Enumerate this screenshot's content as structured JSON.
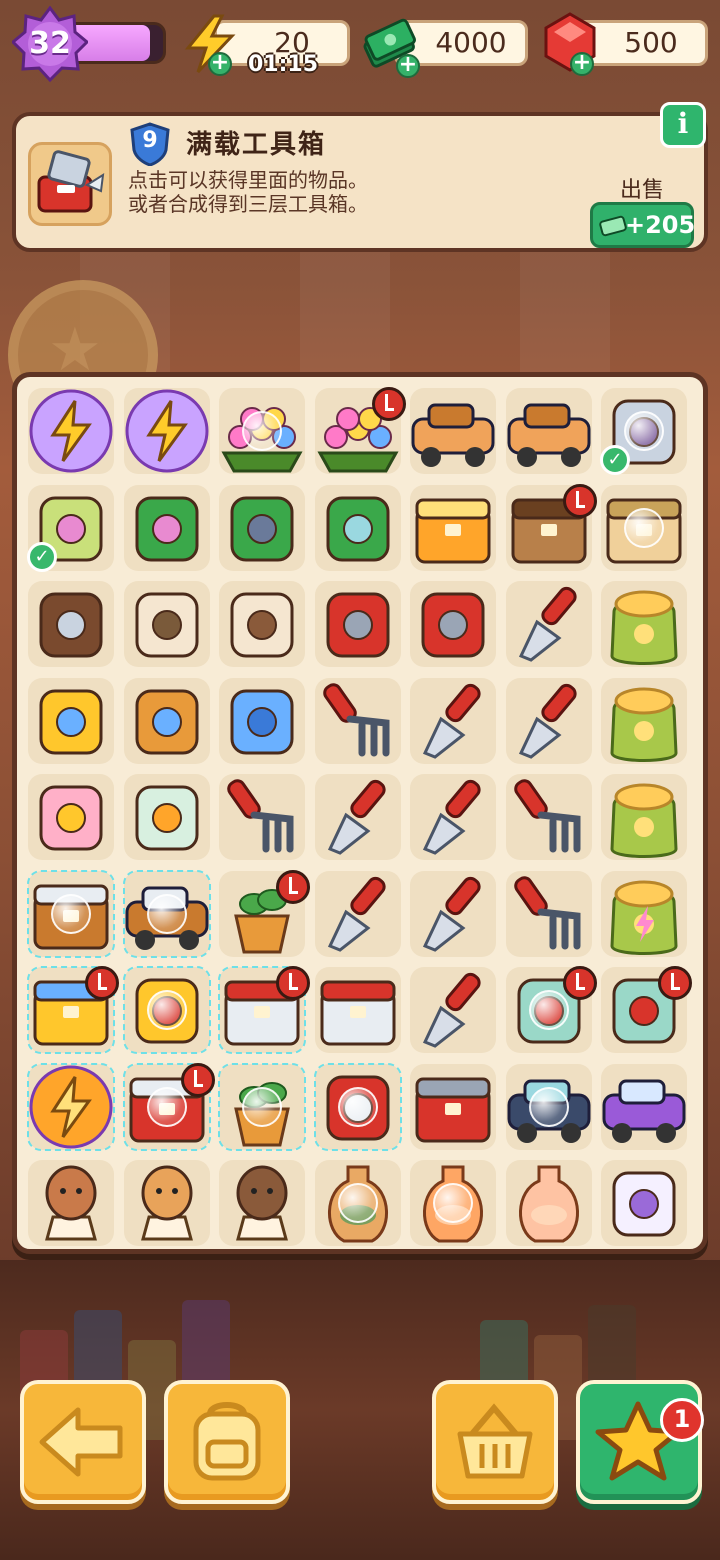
{
  "player": {
    "level": "32",
    "xp_fraction": 0.85
  },
  "resources": {
    "energy": {
      "value": "20",
      "timer": "01:15",
      "icon": "lightning-icon"
    },
    "cash": {
      "value": "4000",
      "icon": "cash-stack-icon"
    },
    "gems": {
      "value": "500",
      "icon": "ruby-icon"
    }
  },
  "info_panel": {
    "level": "9",
    "title": "满载工具箱",
    "desc_line1": "点击可以获得里面的物品。",
    "desc_line2": "或者合成得到三层工具箱。",
    "sell_label": "出售",
    "sell_price": "+205",
    "info_button": "i"
  },
  "board": {
    "rows": [
      [
        "energy-orb",
        "energy-orb",
        "flower-bouquet",
        "flower-bouquet-timer",
        "cardboard-stack",
        "cardboard-box",
        "mouse-nurse"
      ],
      [
        "spray-bottle",
        "squeegee",
        "broom-handle",
        "hand-broom",
        "juice-box",
        "treasure-chest",
        "tissue-box"
      ],
      [
        "folder",
        "wanted-poster",
        "seed-packet",
        "pruning-shears",
        "hatchet",
        "shovel",
        "coin-sack"
      ],
      [
        "sunglasses",
        "magnifying-glass",
        "blue-button",
        "garden-fork",
        "trowel",
        "trowel",
        "coin-sack"
      ],
      [
        "ice-cream-sundae",
        "bubble-tea",
        "garden-fork",
        "trowel",
        "trowel",
        "garden-fork",
        "coin-sack-glow"
      ],
      [
        "crate-locked",
        "cart-locked",
        "potted-plant",
        "trowel",
        "trowel",
        "garden-fork",
        "coin-sack-energy"
      ],
      [
        "tray-locked",
        "lamp-locked",
        "supply-box-locked",
        "first-aid-box",
        "trowel",
        "medicine-jars",
        "medicine-jars"
      ],
      [
        "energy-locked",
        "toolbox-robot",
        "seedling-pot",
        "tape-dispenser",
        "toolbox",
        "jeep",
        "purple-car"
      ],
      [
        "alpaca-bust",
        "tiger-bust",
        "yak-bust",
        "dragon-vase",
        "orange-vase",
        "peach-vase",
        "pearl-lamp"
      ]
    ]
  },
  "bottom_bar": {
    "back": "back-arrow-icon",
    "backpack": "backpack-icon",
    "basket": "basket-icon",
    "favorites": "star-icon",
    "favorites_badge": "1"
  }
}
